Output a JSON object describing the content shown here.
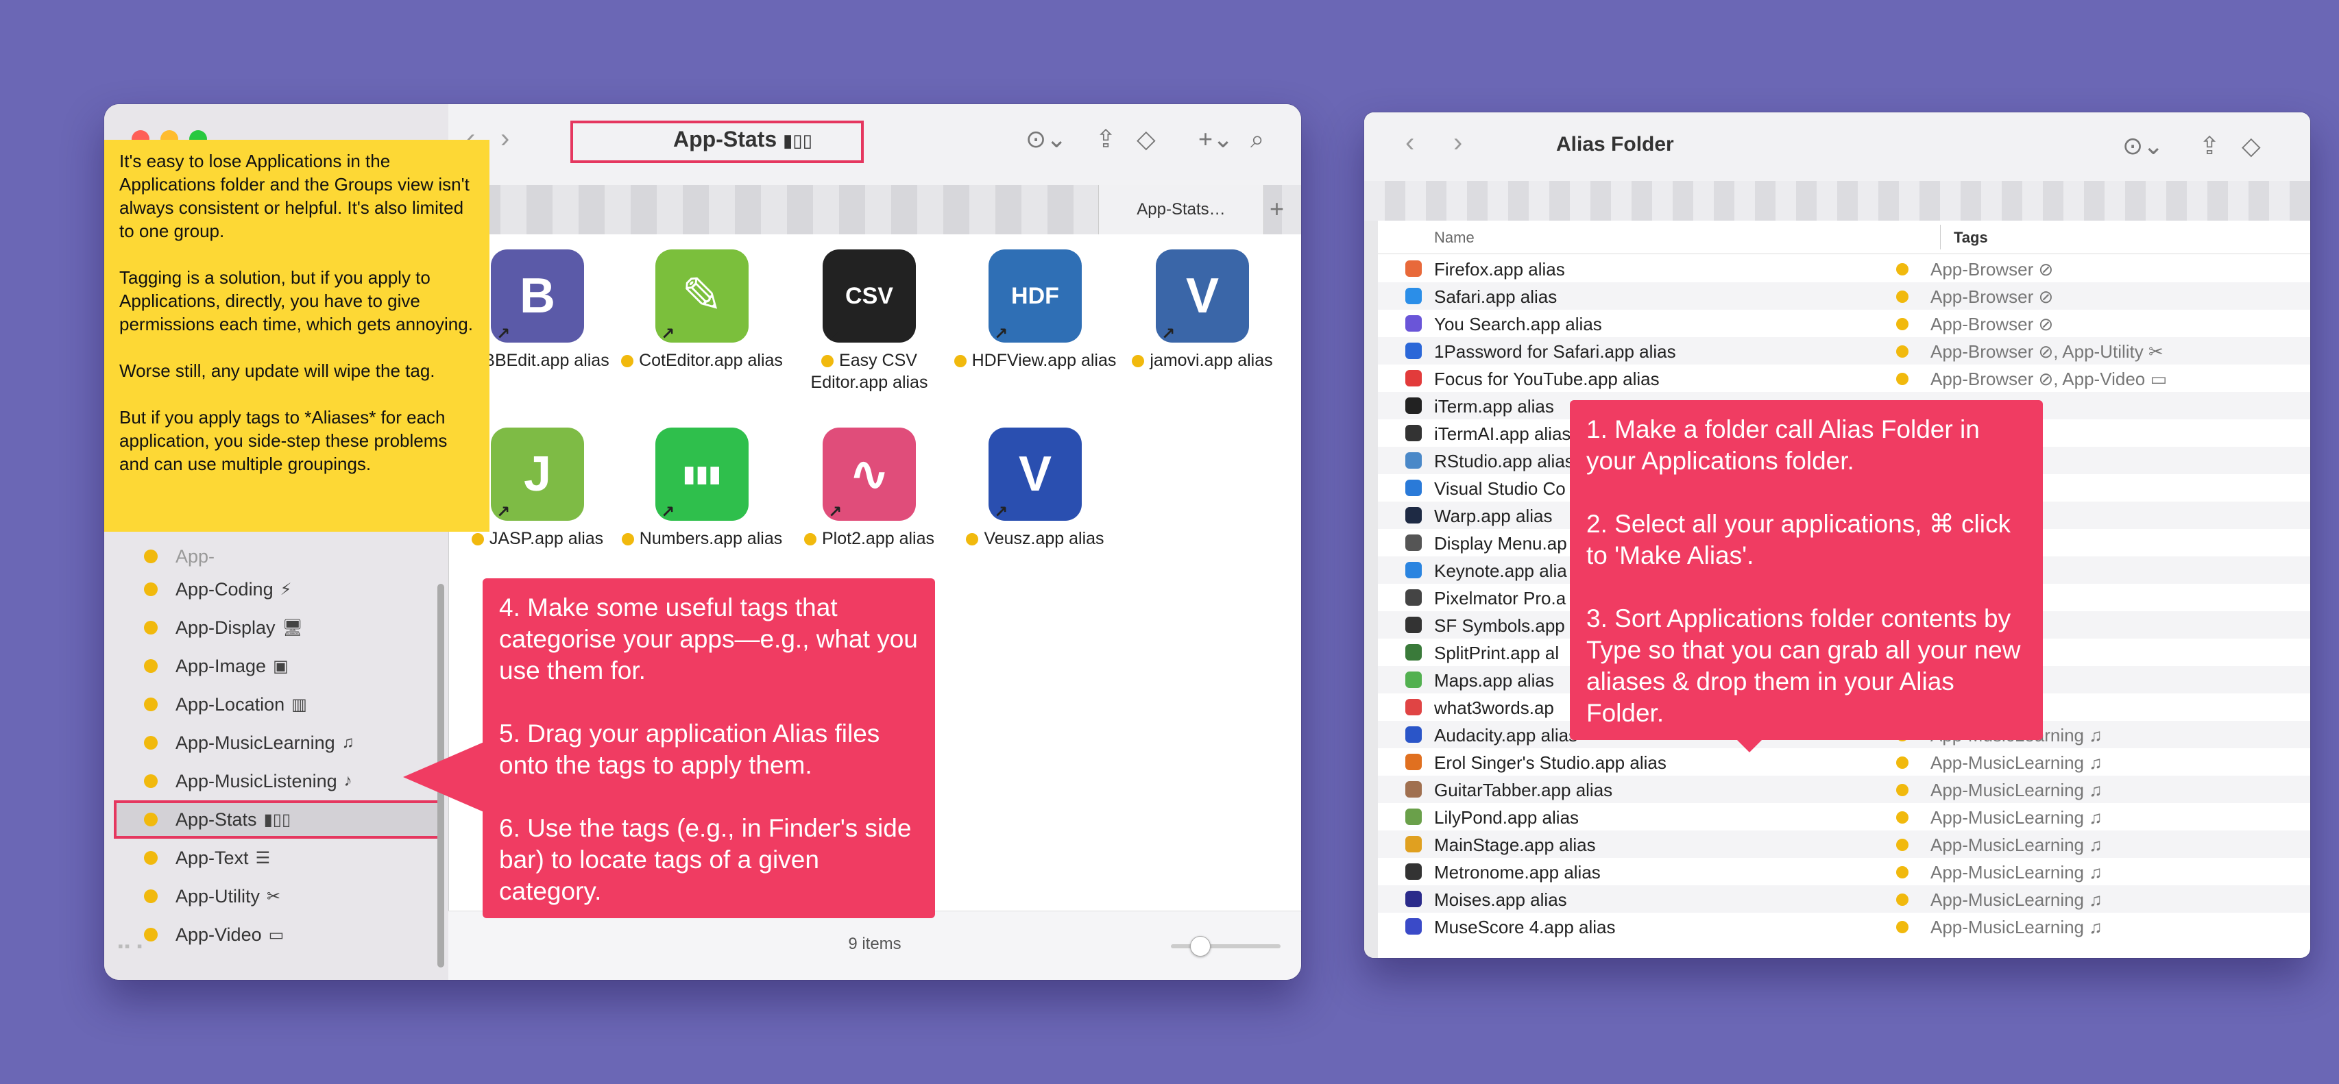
{
  "left_window": {
    "title": "App-Stats",
    "title_icon": "bar-chart-icon",
    "tab_label": "App-Stats…",
    "status": "9 items",
    "sidebar_items": [
      {
        "label": "App-Coding",
        "icon": "⚡"
      },
      {
        "label": "App-Display",
        "icon": "🖥"
      },
      {
        "label": "App-Image",
        "icon": "▣"
      },
      {
        "label": "App-Location",
        "icon": "▥"
      },
      {
        "label": "App-MusicLearning",
        "icon": "♫"
      },
      {
        "label": "App-MusicListening",
        "icon": "♪"
      },
      {
        "label": "App-Stats",
        "icon": "▮▯▯"
      },
      {
        "label": "App-Text",
        "icon": "☰"
      },
      {
        "label": "App-Utility",
        "icon": "✂"
      },
      {
        "label": "App-Video",
        "icon": "▭"
      }
    ],
    "files": [
      {
        "name": "BBEdit.app alias",
        "glyph": "B",
        "color": "#5b5aa8"
      },
      {
        "name": "CotEditor.app alias",
        "glyph": "✎",
        "color": "#7bbf3c"
      },
      {
        "name": "Easy CSV Editor.app alias",
        "glyph": "CSV",
        "color": "#222222"
      },
      {
        "name": "HDFView.app alias",
        "glyph": "HDF",
        "color": "#2f6fb5"
      },
      {
        "name": "jamovi.app alias",
        "glyph": "V",
        "color": "#3a66a8"
      },
      {
        "name": "JASP.app alias",
        "glyph": "J",
        "color": "#7ebb45"
      },
      {
        "name": "Numbers.app alias",
        "glyph": "▮▮▮",
        "color": "#2fbf4c"
      },
      {
        "name": "Plot2.app alias",
        "glyph": "∿",
        "color": "#e04d7a"
      },
      {
        "name": "Veusz.app alias",
        "glyph": "V",
        "color": "#2a4fb0"
      }
    ]
  },
  "right_window": {
    "title": "Alias Folder",
    "col_name": "Name",
    "col_tags": "Tags",
    "rows": [
      {
        "name": "Firefox.app alias",
        "tags": "App-Browser ⊘",
        "color": "#e8693a"
      },
      {
        "name": "Safari.app alias",
        "tags": "App-Browser ⊘",
        "color": "#2b8ee8"
      },
      {
        "name": "You Search.app alias",
        "tags": "App-Browser ⊘",
        "color": "#6a55d8"
      },
      {
        "name": "1Password for Safari.app alias",
        "tags": "App-Browser ⊘, App-Utility ✂",
        "color": "#2b67d8"
      },
      {
        "name": "Focus for YouTube.app alias",
        "tags": "App-Browser ⊘, App-Video ▭",
        "color": "#e23b3b"
      },
      {
        "name": "iTerm.app alias",
        "tags": "",
        "color": "#222222"
      },
      {
        "name": "iTermAI.app alias",
        "tags": "",
        "color": "#333333"
      },
      {
        "name": "RStudio.app alias",
        "tags": "",
        "color": "#4a88c8"
      },
      {
        "name": "Visual Studio Co",
        "tags": "",
        "color": "#2a7ad8"
      },
      {
        "name": "Warp.app alias",
        "tags": "",
        "color": "#1e2a44"
      },
      {
        "name": "Display Menu.ap",
        "tags": "",
        "color": "#555555"
      },
      {
        "name": "Keynote.app alia",
        "tags": "",
        "color": "#2a84e0"
      },
      {
        "name": "Pixelmator Pro.a",
        "tags": "",
        "color": "#444444"
      },
      {
        "name": "SF Symbols.app",
        "tags": "",
        "color": "#333333"
      },
      {
        "name": "SplitPrint.app al",
        "tags": "",
        "color": "#3a7a3a"
      },
      {
        "name": "Maps.app alias",
        "tags": "",
        "color": "#52b050"
      },
      {
        "name": "what3words.ap",
        "tags": "",
        "color": "#e04444"
      },
      {
        "name": "Audacity.app alias",
        "tags": "App-MusicLearning ♫",
        "color": "#2a55c8"
      },
      {
        "name": "Erol Singer's Studio.app alias",
        "tags": "App-MusicLearning ♫",
        "color": "#e07020"
      },
      {
        "name": "GuitarTabber.app alias",
        "tags": "App-MusicLearning ♫",
        "color": "#a07050"
      },
      {
        "name": "LilyPond.app alias",
        "tags": "App-MusicLearning ♫",
        "color": "#6aa04a"
      },
      {
        "name": "MainStage.app alias",
        "tags": "App-MusicLearning ♫",
        "color": "#e0a020"
      },
      {
        "name": "Metronome.app alias",
        "tags": "App-MusicLearning ♫",
        "color": "#333333"
      },
      {
        "name": "Moises.app alias",
        "tags": "App-MusicLearning ♫",
        "color": "#2a2a8a"
      },
      {
        "name": "MuseScore 4.app alias",
        "tags": "App-MusicLearning ♫",
        "color": "#3a4ac8"
      }
    ]
  },
  "notes": {
    "yellow": [
      "It's easy to lose Applications in the Applications folder and the Groups view isn't always consistent or helpful. It's also limited to one group.",
      "Tagging is a solution, but if you apply to Applications, directly, you have to give permissions each time, which gets annoying.",
      "Worse still, any update will wipe the tag.",
      "But if you apply tags to *Aliases* for each application, you side-step these problems and can use multiple groupings."
    ],
    "red_left": [
      "4. Make some useful tags that categorise your apps—e.g., what you use them for.",
      "5. Drag your application Alias files onto the tags to apply them.",
      "6. Use the tags (e.g., in Finder's side bar) to locate tags of a given category."
    ],
    "red_right": [
      "1. Make a folder call Alias Folder in your Applications folder.",
      "2. Select all your applications, ⌘ click to 'Make Alias'.",
      "3. Sort Applications folder contents by Type so that you can grab all your new aliases & drop them in your Alias Folder."
    ]
  },
  "colors": {
    "background": "#6b67b5",
    "tag_yellow": "#f1b90d",
    "note_red": "#f03c62",
    "note_yellow": "#fdd835"
  }
}
